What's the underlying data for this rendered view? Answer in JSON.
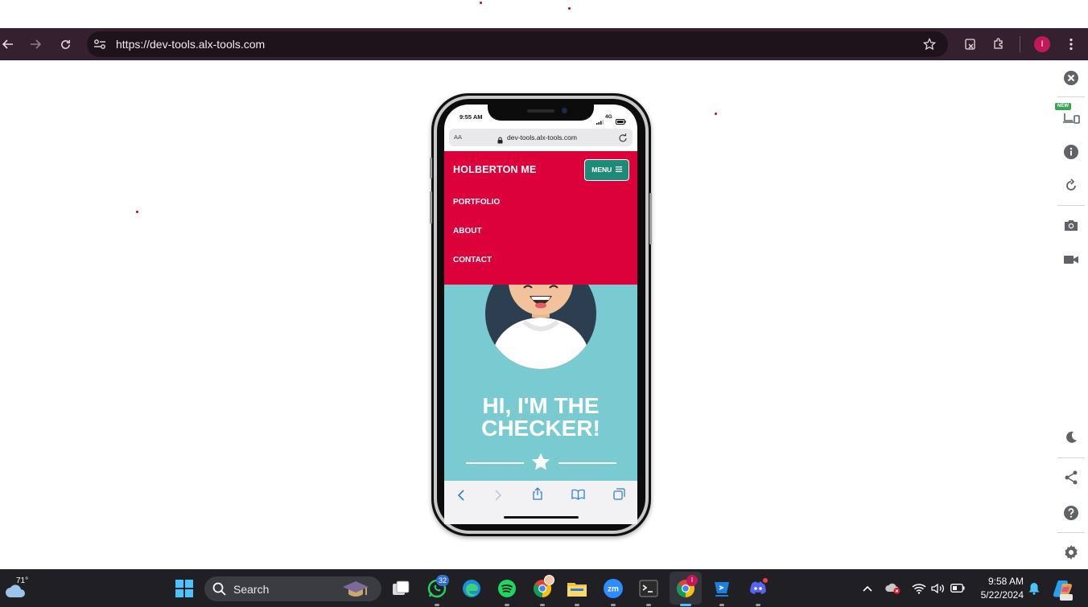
{
  "browser": {
    "url": "https://dev-tools.alx-tools.com",
    "profile_initial": "I"
  },
  "phone": {
    "status_time": "9:55 AM",
    "network": "4G",
    "address_text": "dev-tools.alx-tools.com",
    "text_size_label": "AA"
  },
  "site": {
    "brand": "HOLBERTON ME",
    "menu_label": "MENU",
    "nav": [
      "PORTFOLIO",
      "ABOUT",
      "CONTACT"
    ],
    "hero_title_line1": "HI, I'M THE",
    "hero_title_line2": "CHECKER!"
  },
  "tool_rail": {
    "new_badge": "NEW"
  },
  "taskbar": {
    "weather_temp": "71°",
    "search_label": "Search",
    "whatsapp_badge": "32",
    "chrome_badge": "I",
    "clock_time": "9:58 AM",
    "clock_date": "5/22/2024"
  },
  "colors": {
    "browser_bar": "#35202f",
    "site_header": "#dc003b",
    "menu_button": "#1e8a78",
    "hero": "#79cbd1",
    "taskbar": "#1f1f24"
  }
}
